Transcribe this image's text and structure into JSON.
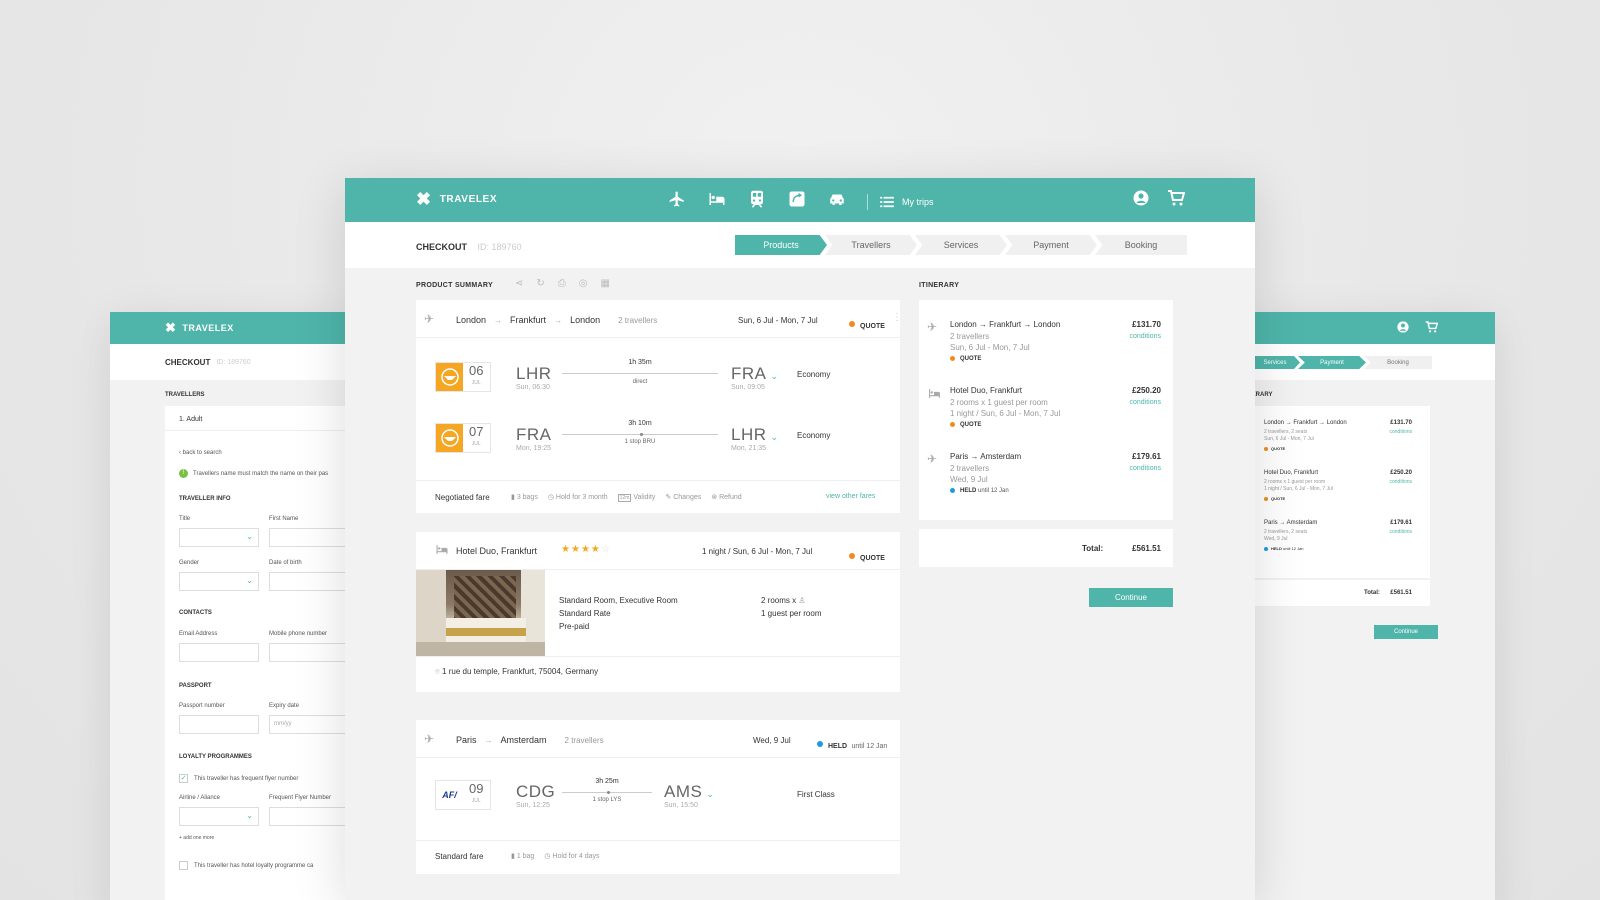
{
  "brand": {
    "name": "TRAVELEX",
    "accent": "#4fb5aa"
  },
  "nav": {
    "icons": [
      "plane-icon",
      "bed-icon",
      "train-icon",
      "car-rental-icon",
      "car-icon"
    ],
    "my_trips": "My trips"
  },
  "checkout": {
    "title": "CHECKOUT",
    "id": "ID: 189760"
  },
  "steps": [
    "Products",
    "Travellers",
    "Services",
    "Payment",
    "Booking"
  ],
  "active_step": "Products",
  "product_summary": {
    "label": "PRODUCT SUMMARY",
    "flight1": {
      "route": [
        "London",
        "Frankfurt",
        "London"
      ],
      "travellers": "2 travellers",
      "dates": "Sun, 6 Jul - Mon, 7 Jul",
      "status": "QUOTE",
      "legs": [
        {
          "day": "06",
          "month": "JUL",
          "from": "LHR",
          "from_time": "Sun, 06:30",
          "duration": "1h 35m",
          "stops": "direct",
          "to": "FRA",
          "to_time": "Sun, 09:05",
          "cabin": "Economy"
        },
        {
          "day": "07",
          "month": "JUL",
          "from": "FRA",
          "from_time": "Mon, 19:25",
          "duration": "3h 10m",
          "stops": "1 stop BRU",
          "to": "LHR",
          "to_time": "Mon, 21:35",
          "cabin": "Economy"
        }
      ],
      "fare": "Negotiated fare",
      "fare_items": [
        "3 bags",
        "Hold for 3 month",
        "12m",
        "Validity",
        "Changes",
        "Refund"
      ],
      "other_fares": "view other fares"
    },
    "hotel": {
      "name": "Hotel Duo, Frankfurt",
      "stars": 4,
      "stars_max": 5,
      "dates": "1 night / Sun, 6 Jul - Mon, 7 Jul",
      "status": "QUOTE",
      "room_lines": [
        "Standard Room, Executive Room",
        "Standard Rate",
        "Pre-paid"
      ],
      "rooms": "2 rooms x",
      "guests": "1 guest per room",
      "address": "1 rue du temple, Frankfurt, 75004, Germany"
    },
    "flight2": {
      "route": [
        "Paris",
        "Amsterdam"
      ],
      "travellers": "2 travellers",
      "date": "Wed, 9 Jul",
      "status": "HELD",
      "status_note": "until 12 Jan",
      "leg": {
        "airline": "AF/",
        "day": "09",
        "month": "JUL",
        "from": "CDG",
        "from_time": "Sun, 12:25",
        "duration": "3h 25m",
        "stops": "1 stop LYS",
        "to": "AMS",
        "to_time": "Sun, 15:50",
        "cabin": "First Class"
      },
      "fare": "Standard fare",
      "fare_items": [
        "1 bag",
        "Hold for 4 days"
      ]
    }
  },
  "itinerary": {
    "label": "ITINERARY",
    "items": [
      {
        "title": "London → Frankfurt → London",
        "line1": "2 travellers",
        "line2": "Sun, 6 Jul - Mon, 7 Jul",
        "status": "QUOTE",
        "price": "£131.70",
        "link": "conditions"
      },
      {
        "title": "Hotel Duo, Frankfurt",
        "line1": "2 rooms x 1 guest per room",
        "line2": "1 night / Sun, 6 Jul - Mon, 7 Jul",
        "status": "QUOTE",
        "price": "£250.20",
        "link": "conditions"
      },
      {
        "title": "Paris → Amsterdam",
        "line1": "2 travellers",
        "line2": "Wed, 9 Jul",
        "status": "HELD",
        "status_note": "until 12 Jan",
        "price": "£179.61",
        "link": "conditions"
      }
    ],
    "total_label": "Total:",
    "total": "£561.51",
    "continue": "Continue"
  },
  "left_screen": {
    "section": "TRAVELLERS",
    "traveller": "1.  Adult",
    "back": "‹  back to search",
    "notice": "Travellers name must match the name on their pas",
    "traveller_info": "TRAVELLER INFO",
    "fields": {
      "title": "Title",
      "first_name": "First Name",
      "gender": "Gender",
      "dob": "Date of birth"
    },
    "contacts": "CONTACTS",
    "email": "Email Address",
    "mobile": "Mobile phone number",
    "passport": "PASSPORT",
    "passport_number": "Passport number",
    "expiry": "Expiry date",
    "expiry_placeholder": "mm/yy",
    "loyalty": "LOYALTY PROGRAMMES",
    "ff_check": "This traveller has frequent flyer number",
    "airline": "Airline / Aliance",
    "ff_number": "Frequent Flyer Number",
    "add_more": "+ add one more",
    "hotel_check": "This traveller has hotel loyalty programme ca"
  },
  "right_screen": {
    "steps": [
      "Services",
      "Payment",
      "Booking"
    ],
    "section": "IERARY",
    "items": [
      {
        "title": "London → Frankfurt → London",
        "line1": "2 travellers, 2 seats",
        "line2": "Sun, 6 Jul - Mon, 7 Jul",
        "status": "QUOTE",
        "price": "£131.70",
        "link": "conditions"
      },
      {
        "title": "Hotel Duo, Frankfurt",
        "line1": "2 rooms x 1 guest per room",
        "line2": "1 night / Sun, 6 Jul - Mon, 7 Jul",
        "status": "QUOTE",
        "price": "£250.20",
        "link": "conditions"
      },
      {
        "title": "Paris → Amsterdam",
        "line1": "2 travellers, 2 seats",
        "line2": "Wed, 9 Jul",
        "status": "HELD",
        "status_note": "until 12 Jan",
        "price": "£179.61",
        "link": "conditions"
      }
    ],
    "total_label": "Total:",
    "total": "£561.51",
    "continue": "Continue"
  }
}
